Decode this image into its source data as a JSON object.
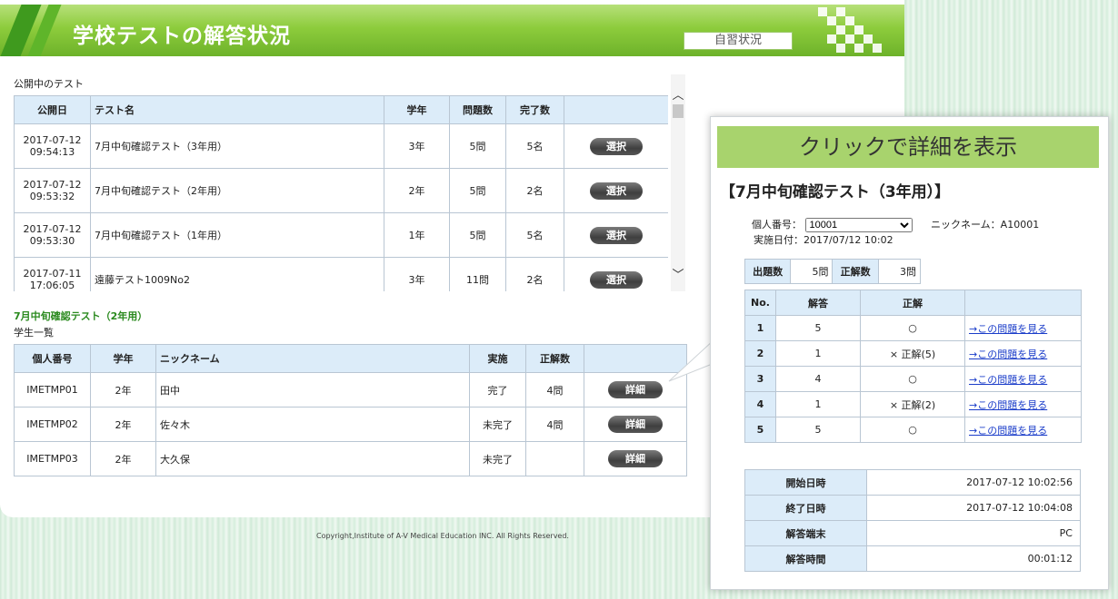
{
  "header": {
    "title": "学校テストの解答状況",
    "self_study_button": "自習状況"
  },
  "tests_section": {
    "label": "公開中のテスト",
    "columns": [
      "公開日",
      "テスト名",
      "学年",
      "問題数",
      "完了数",
      ""
    ],
    "rows": [
      {
        "date": "2017-07-12",
        "time": "09:54:13",
        "name": "7月中旬確認テスト（3年用）",
        "grade": "3年",
        "questions": "5問",
        "completed": "5名",
        "button": "選択"
      },
      {
        "date": "2017-07-12",
        "time": "09:53:32",
        "name": "7月中旬確認テスト（2年用）",
        "grade": "2年",
        "questions": "5問",
        "completed": "2名",
        "button": "選択"
      },
      {
        "date": "2017-07-12",
        "time": "09:53:30",
        "name": "7月中旬確認テスト（1年用）",
        "grade": "1年",
        "questions": "5問",
        "completed": "5名",
        "button": "選択"
      },
      {
        "date": "2017-07-11",
        "time": "17:06:05",
        "name": "遠藤テスト1009No2",
        "grade": "3年",
        "questions": "11問",
        "completed": "2名",
        "button": "選択"
      }
    ]
  },
  "students_section": {
    "test_title": "7月中旬確認テスト（2年用）",
    "label": "学生一覧",
    "columns": [
      "個人番号",
      "学年",
      "ニックネーム",
      "実施",
      "正解数",
      ""
    ],
    "rows": [
      {
        "id": "IMETMP01",
        "grade": "2年",
        "nickname": "田中",
        "status": "完了",
        "correct": "4問",
        "button": "詳細"
      },
      {
        "id": "IMETMP02",
        "grade": "2年",
        "nickname": "佐々木",
        "status": "未完了",
        "correct": "4問",
        "button": "詳細"
      },
      {
        "id": "IMETMP03",
        "grade": "2年",
        "nickname": "大久保",
        "status": "未完了",
        "correct": "",
        "button": "詳細"
      }
    ]
  },
  "footer": {
    "copyright": "Copyright,Institute of A-V Medical Education INC. All Rights Reserved."
  },
  "popup": {
    "header": "クリックで詳細を表示",
    "title": "【7月中旬確認テスト（3年用）】",
    "id_label": "個人番号：",
    "id_value": "10001",
    "nickname_label": "ニックネーム：",
    "nickname_value": "A10001",
    "date_label": "実施日付：",
    "date_value": "2017/07/12 10:02",
    "summary": {
      "questions_label": "出題数",
      "questions_value": "5問",
      "correct_label": "正解数",
      "correct_value": "3問"
    },
    "answers_columns": [
      "No.",
      "解答",
      "正解",
      ""
    ],
    "answers": [
      {
        "no": "1",
        "answer": "5",
        "correct": "○",
        "link": "→この問題を見る"
      },
      {
        "no": "2",
        "answer": "1",
        "correct": "×  正解(5)",
        "link": "→この問題を見る"
      },
      {
        "no": "3",
        "answer": "4",
        "correct": "○",
        "link": "→この問題を見る"
      },
      {
        "no": "4",
        "answer": "1",
        "correct": "×  正解(2)",
        "link": "→この問題を見る"
      },
      {
        "no": "5",
        "answer": "5",
        "correct": "○",
        "link": "→この問題を見る"
      }
    ],
    "info": [
      {
        "label": "開始日時",
        "value": "2017-07-12 10:02:56"
      },
      {
        "label": "終了日時",
        "value": "2017-07-12 10:04:08"
      },
      {
        "label": "解答端末",
        "value": "PC"
      },
      {
        "label": "解答時間",
        "value": "00:01:12"
      }
    ]
  }
}
